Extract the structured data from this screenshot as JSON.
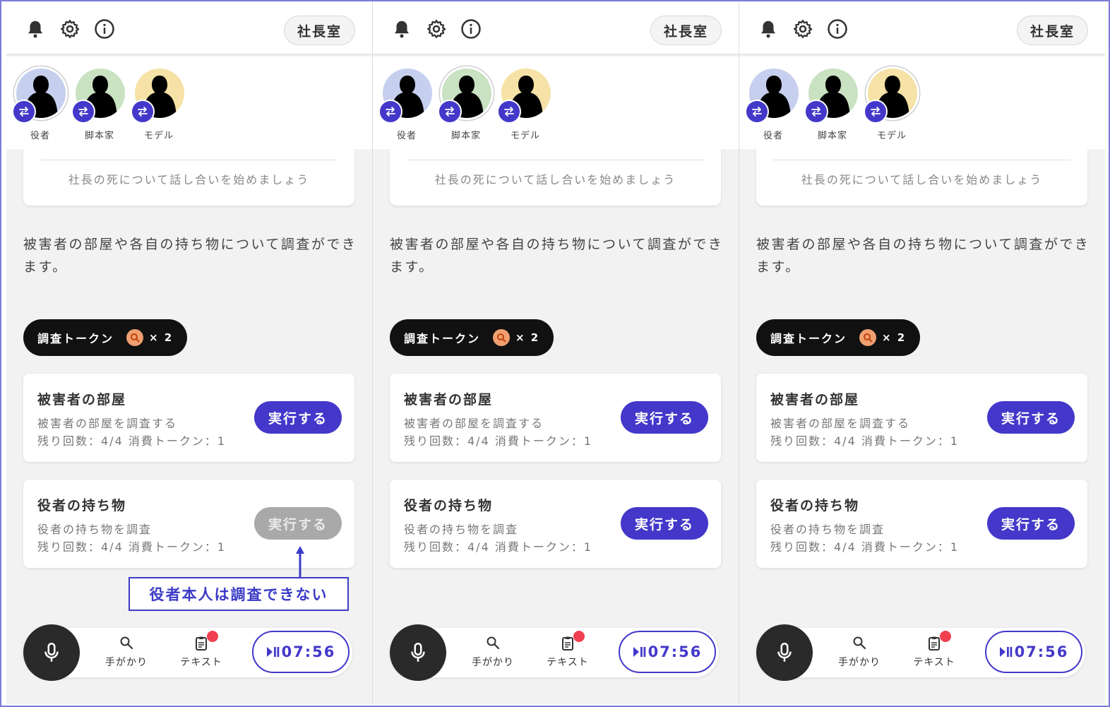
{
  "app": {
    "room_label": "社長室",
    "message": "社長の死について話し合いを始めましょう",
    "description": "被害者の部屋や各自の持ち物について調査ができます。",
    "token": {
      "label": "調査トークン",
      "count": "× 2",
      "icon": "magnifier-icon"
    },
    "characters": [
      {
        "name": "役者",
        "color": "#c6cfee"
      },
      {
        "name": "脚本家",
        "color": "#c9e2c2"
      },
      {
        "name": "モデル",
        "color": "#f6e2a6"
      }
    ],
    "actions": [
      {
        "title": "被害者の部屋",
        "subtitle": "被害者の部屋を調査する",
        "info": "残り回数：4/4 消費トークン：1"
      },
      {
        "title": "役者の持ち物",
        "subtitle": "役者の持ち物を調査",
        "info": "残り回数：4/4 消費トークン：1"
      }
    ],
    "run_label": "実行する",
    "nav": {
      "clues": "手がかり",
      "text": "テキスト",
      "timer": "07:56"
    }
  },
  "panels": [
    {
      "selected_character": 0,
      "disabled_action": 1
    },
    {
      "selected_character": 1,
      "disabled_action": null
    },
    {
      "selected_character": 2,
      "disabled_action": null
    }
  ],
  "annotation": "役者本人は調査できない",
  "colors": {
    "accent": "#4338ca",
    "disabled": "#a9a9a9",
    "badge": "#f04050",
    "token_icon": "#f0a070"
  }
}
